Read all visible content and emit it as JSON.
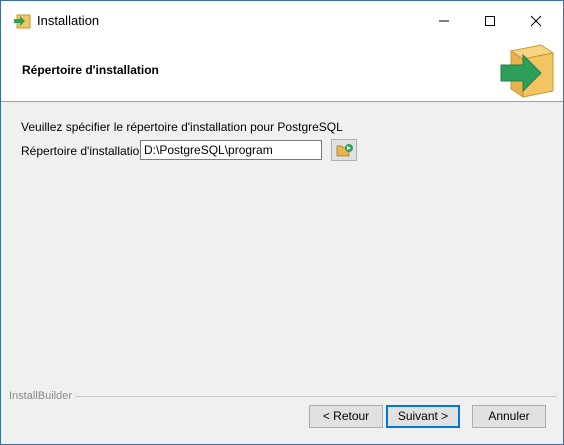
{
  "window": {
    "title": "Installation",
    "app_icon": "installer-box-arrow-icon",
    "controls": {
      "minimize": "minimize-icon",
      "maximize": "maximize-icon",
      "close": "close-icon"
    }
  },
  "header": {
    "title": "Répertoire d'installation",
    "icon": "installer-box-arrow-icon"
  },
  "content": {
    "prompt": "Veuillez spécifier le répertoire d'installation pour PostgreSQL",
    "directory_label": "Répertoire d'installation",
    "directory_value": "D:\\PostgreSQL\\program",
    "browse_icon": "folder-browse-icon"
  },
  "footer": {
    "brand": "InstallBuilder",
    "back_label": "< Retour",
    "next_label": "Suivant >",
    "cancel_label": "Annuler"
  },
  "colors": {
    "arrow_green": "#2e9e5b",
    "box_yellow": "#f2c462",
    "focus_blue": "#0078d7"
  }
}
